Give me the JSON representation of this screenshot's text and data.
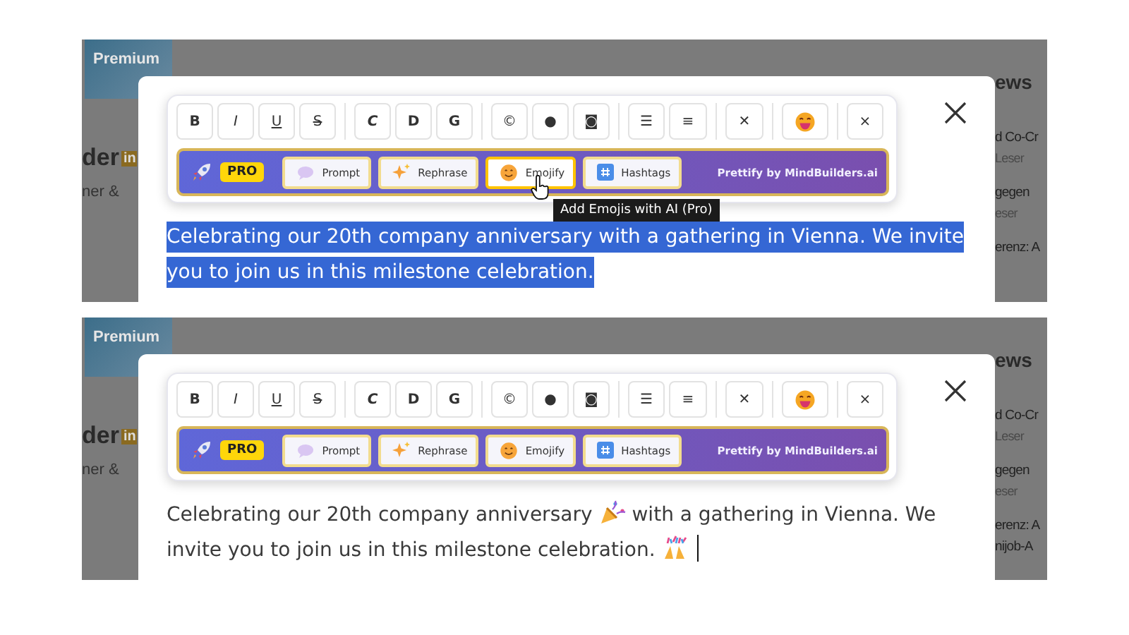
{
  "panels": [
    {
      "background": {
        "card_label": "Premium",
        "name": "der",
        "name_badge": "in",
        "subtitle": "ner &",
        "heading": "ews",
        "items": [
          {
            "kind": "title",
            "text": "d Co-Cr"
          },
          {
            "kind": "meta",
            "text": "Leser"
          },
          {
            "kind": "title",
            "text": "gegen"
          },
          {
            "kind": "meta",
            "text": "eser"
          },
          {
            "kind": "title",
            "text": "erenz: A"
          }
        ]
      },
      "toolbar": {
        "groups": [
          [
            {
              "kind": "text",
              "label": "B"
            },
            {
              "kind": "text",
              "label": "I"
            },
            {
              "kind": "text",
              "label": "U"
            },
            {
              "kind": "text",
              "label": "S"
            }
          ],
          [
            {
              "kind": "text",
              "label": "C"
            },
            {
              "kind": "text",
              "label": "D"
            },
            {
              "kind": "text",
              "label": "G"
            }
          ],
          [
            {
              "kind": "text",
              "label": "©"
            },
            {
              "kind": "text",
              "label": "●"
            },
            {
              "kind": "text",
              "label": "◙"
            }
          ],
          [
            {
              "kind": "text",
              "label": "☰"
            },
            {
              "kind": "text",
              "label": "≡"
            }
          ],
          [
            {
              "kind": "text",
              "label": "✕"
            }
          ],
          [
            {
              "kind": "emoji"
            }
          ],
          [
            {
              "kind": "text",
              "label": "×"
            }
          ]
        ]
      },
      "pro_bar": {
        "badge": "PRO",
        "credit": "Prettify by MindBuilders.ai",
        "buttons": [
          {
            "kind": "prompt",
            "label": "Prompt",
            "hovered": false
          },
          {
            "kind": "rephrase",
            "label": "Rephrase",
            "hovered": false
          },
          {
            "kind": "emojify",
            "label": "Emojify",
            "hovered": true
          },
          {
            "kind": "hashtags",
            "label": "Hashtags",
            "hovered": false
          }
        ]
      },
      "tooltip": "Add Emojis with AI (Pro)",
      "editor": {
        "selected": true,
        "segments": [
          {
            "kind": "text",
            "text": "Celebrating our 20th company anniversary with a gathering in Vienna. We invite you to join us in this milestone celebration."
          }
        ]
      }
    },
    {
      "background": {
        "card_label": "Premium",
        "name": "der",
        "name_badge": "in",
        "subtitle": "ner &",
        "heading": "ews",
        "items": [
          {
            "kind": "title",
            "text": "d Co-Cr"
          },
          {
            "kind": "meta",
            "text": "Leser"
          },
          {
            "kind": "title",
            "text": "gegen"
          },
          {
            "kind": "meta",
            "text": "eser"
          },
          {
            "kind": "title",
            "text": "erenz: A"
          },
          {
            "kind": "title",
            "text": "nijob-A"
          }
        ]
      },
      "toolbar": {
        "groups": [
          [
            {
              "kind": "text",
              "label": "B"
            },
            {
              "kind": "text",
              "label": "I"
            },
            {
              "kind": "text",
              "label": "U"
            },
            {
              "kind": "text",
              "label": "S"
            }
          ],
          [
            {
              "kind": "text",
              "label": "C"
            },
            {
              "kind": "text",
              "label": "D"
            },
            {
              "kind": "text",
              "label": "G"
            }
          ],
          [
            {
              "kind": "text",
              "label": "©"
            },
            {
              "kind": "text",
              "label": "●"
            },
            {
              "kind": "text",
              "label": "◙"
            }
          ],
          [
            {
              "kind": "text",
              "label": "☰"
            },
            {
              "kind": "text",
              "label": "≡"
            }
          ],
          [
            {
              "kind": "text",
              "label": "✕"
            }
          ],
          [
            {
              "kind": "emoji"
            }
          ],
          [
            {
              "kind": "text",
              "label": "×"
            }
          ]
        ]
      },
      "pro_bar": {
        "badge": "PRO",
        "credit": "Prettify by MindBuilders.ai",
        "buttons": [
          {
            "kind": "prompt",
            "label": "Prompt",
            "hovered": false
          },
          {
            "kind": "rephrase",
            "label": "Rephrase",
            "hovered": false
          },
          {
            "kind": "emojify",
            "label": "Emojify",
            "hovered": false
          },
          {
            "kind": "hashtags",
            "label": "Hashtags",
            "hovered": false
          }
        ]
      },
      "editor": {
        "selected": false,
        "caret": true,
        "segments": [
          {
            "kind": "text",
            "text": "Celebrating our 20th company anniversary"
          },
          {
            "kind": "party"
          },
          {
            "kind": "text",
            "text": "with a gathering in Vienna. We invite you to join us in this milestone celebration."
          },
          {
            "kind": "confetti"
          }
        ]
      }
    }
  ]
}
